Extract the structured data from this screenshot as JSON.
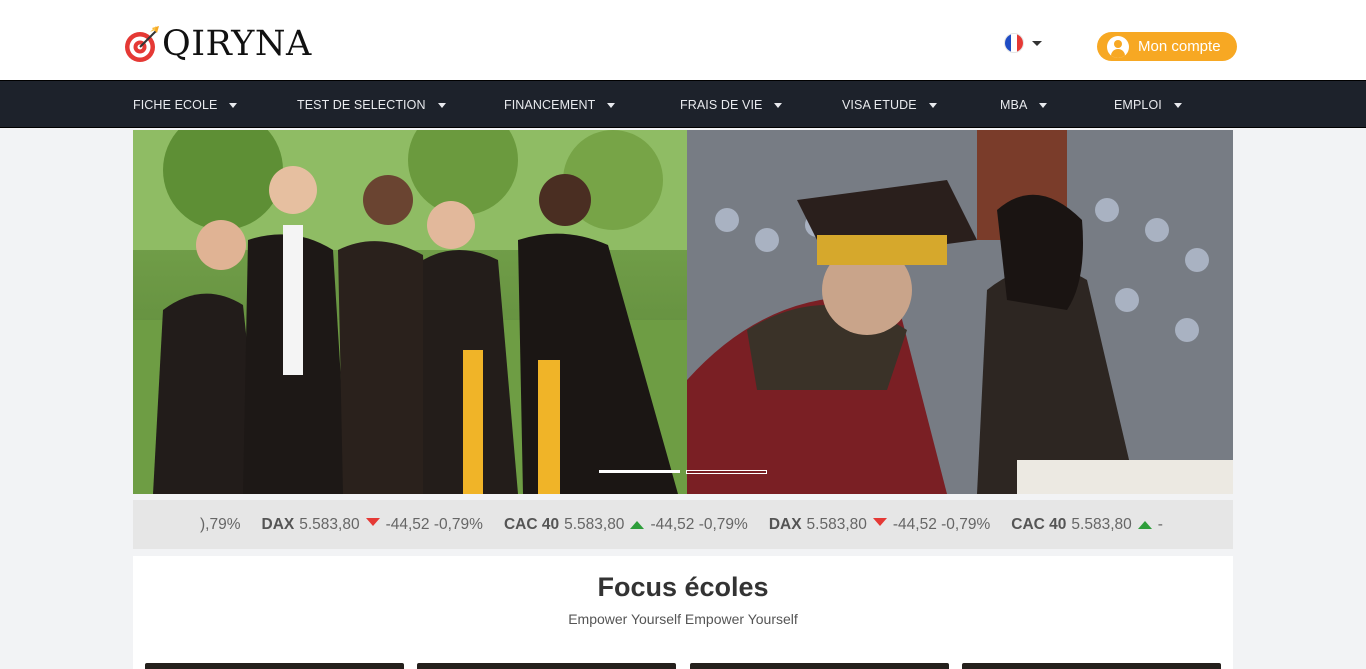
{
  "header": {
    "logo_text": "QIRYNA",
    "account_label": "Mon compte",
    "language": "FR"
  },
  "nav": {
    "items": [
      {
        "label": "FICHE ECOLE"
      },
      {
        "label": "TEST DE SELECTION"
      },
      {
        "label": "FINANCEMENT"
      },
      {
        "label": "FRAIS DE VIE"
      },
      {
        "label": "VISA ETUDE"
      },
      {
        "label": "MBA"
      },
      {
        "label": "EMPLOI"
      }
    ]
  },
  "ticker": {
    "items": [
      {
        "name": "",
        "value": "",
        "change": "),79%",
        "direction": "none"
      },
      {
        "name": "DAX",
        "value": "5.583,80",
        "change": "-44,52 -0,79%",
        "direction": "down"
      },
      {
        "name": "CAC 40",
        "value": "5.583,80",
        "change": "-44,52 -0,79%",
        "direction": "up"
      },
      {
        "name": "DAX",
        "value": "5.583,80",
        "change": "-44,52 -0,79%",
        "direction": "down"
      },
      {
        "name": "CAC 40",
        "value": "5.583,80",
        "change": "-",
        "direction": "up"
      }
    ]
  },
  "focus": {
    "title": "Focus écoles",
    "subtitle": "Empower Yourself Empower Yourself"
  },
  "colors": {
    "accent": "#f7a823",
    "nav_bg": "#1d222b",
    "up": "#2e9e3b",
    "down": "#e53935"
  }
}
